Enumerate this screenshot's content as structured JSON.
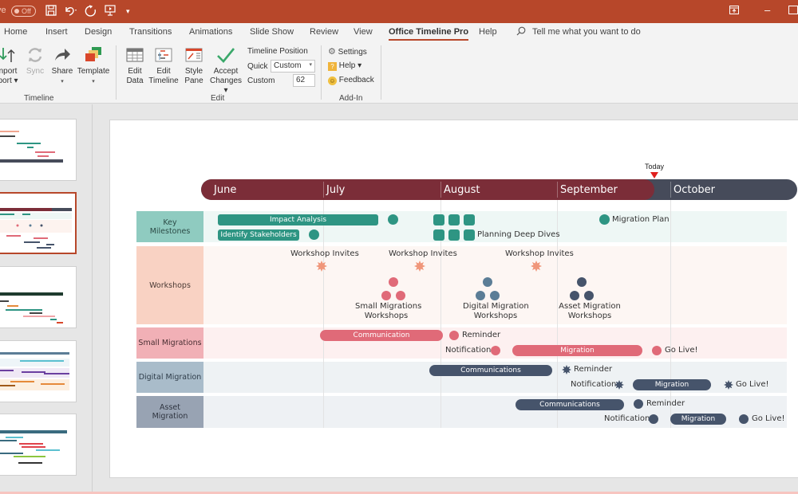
{
  "titlebar": {
    "autosave_label": "ve",
    "autosave_state": "Off",
    "icons": [
      "save-icon",
      "undo-icon",
      "redo-icon",
      "present-icon",
      "customize-qat-icon"
    ],
    "window_buttons": [
      "ribbon-display-options-icon",
      "minimize-icon",
      "maximize-icon"
    ]
  },
  "tabs": [
    {
      "label": "Home"
    },
    {
      "label": "Insert"
    },
    {
      "label": "Design"
    },
    {
      "label": "Transitions"
    },
    {
      "label": "Animations"
    },
    {
      "label": "Slide Show"
    },
    {
      "label": "Review"
    },
    {
      "label": "View"
    },
    {
      "label": "Office Timeline Pro",
      "active": true
    },
    {
      "label": "Help"
    }
  ],
  "tell_me": "Tell me what you want to do",
  "ribbon": {
    "timeline_group": {
      "label": "Timeline",
      "import_line1": "nport",
      "import_line2": "port ▾",
      "sync": "Sync",
      "share": "Share",
      "template": "Template"
    },
    "edit_group": {
      "label": "Edit",
      "edit_data_1": "Edit",
      "edit_data_2": "Data",
      "edit_timeline_1": "Edit",
      "edit_timeline_2": "Timeline",
      "style_pane_1": "Style",
      "style_pane_2": "Pane",
      "accept_1": "Accept",
      "accept_2": "Changes ▾",
      "timeline_position": "Timeline Position",
      "quick_label": "Quick",
      "quick_value": "Custom",
      "custom_label": "Custom",
      "custom_value": "62"
    },
    "addin_group": {
      "label": "Add-In",
      "settings": "Settings",
      "help": "Help ▾",
      "feedback": "Feedback"
    }
  },
  "slides": {
    "count_visible": 5,
    "selected_index": 2
  },
  "timeline": {
    "months": [
      "June",
      "July",
      "August",
      "September",
      "October"
    ],
    "today_label": "Today",
    "colors": {
      "past": "#7b2d38",
      "future": "#464b5a",
      "teal": "#2e9583",
      "salmon": "#f0967a",
      "pink": "#e06a78",
      "steel": "#5b7d96",
      "navy": "#46546b"
    },
    "swimlanes": [
      {
        "label": "Key Milestones"
      },
      {
        "label": "Workshops"
      },
      {
        "label": "Small Migrations"
      },
      {
        "label": "Digital Migration"
      },
      {
        "label": "Asset Migration"
      }
    ],
    "key_milestones": {
      "impact_analysis": "Impact Analysis",
      "identify_stakeholders": "Identify Stakeholders",
      "planning_deep_dives": "Planning Deep Dives",
      "migration_plan": "Migration Plan"
    },
    "workshops": {
      "invites_1": "Workshop Invites",
      "invites_2": "Workshop Invites",
      "invites_3": "Workshop Invites",
      "small_1": "Small Migrations",
      "small_2": "Workshops",
      "digital_1": "Digital Migration",
      "digital_2": "Workshops",
      "asset_1": "Asset Migration",
      "asset_2": "Workshops"
    },
    "small_migrations": {
      "communication": "Communication",
      "reminder": "Reminder",
      "notification": "Notification",
      "migration": "Migration",
      "go_live": "Go Live!"
    },
    "digital_migration": {
      "communications": "Communications",
      "reminder": "Reminder",
      "notification": "Notification",
      "migration": "Migration",
      "go_live": "Go Live!"
    },
    "asset_migration": {
      "communications": "Communications",
      "reminder": "Reminder",
      "notification": "Notification",
      "migration": "Migration",
      "go_live": "Go Live!"
    }
  }
}
